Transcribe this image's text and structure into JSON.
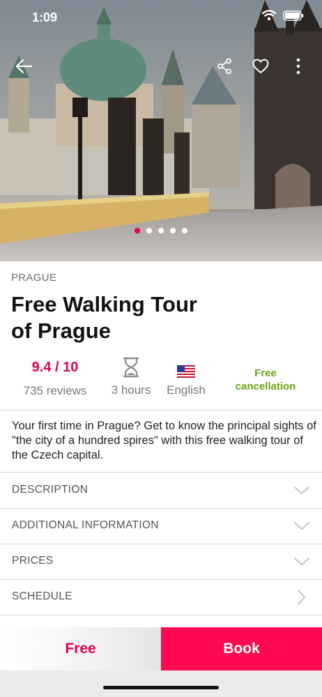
{
  "status_bar": {
    "time": "1:09"
  },
  "hero": {
    "photo_subject": "Charles Bridge, Prague",
    "carousel": {
      "count": 5,
      "active_index": 0
    },
    "icons": [
      "back-arrow-icon",
      "share-icon",
      "heart-icon",
      "more-vertical-icon"
    ]
  },
  "tour": {
    "city": "PRAGUE",
    "title_line1": "Free Walking Tour",
    "title_line2": "of Prague",
    "rating": "9.4 / 10",
    "reviews": "735 reviews",
    "duration": "3 hours",
    "language": "English",
    "cancellation_line1": "Free",
    "cancellation_line2": "cancellation",
    "summary": "Your first time in Prague? Get to know the principal sights of \"the city of a hundred spires\" with this free walking tour of the Czech capital."
  },
  "sections": [
    {
      "label": "DESCRIPTION",
      "icon": "chevron-down-icon"
    },
    {
      "label": "ADDITIONAL INFORMATION",
      "icon": "chevron-down-icon"
    },
    {
      "label": "PRICES",
      "icon": "chevron-down-icon"
    },
    {
      "label": "SCHEDULE",
      "icon": "chevron-right-icon"
    }
  ],
  "footer": {
    "price_label": "Free",
    "book_label": "Book"
  },
  "colors": {
    "accent": "#e5004f",
    "book_button": "#ff0a50",
    "cancellation": "#6aa316"
  }
}
